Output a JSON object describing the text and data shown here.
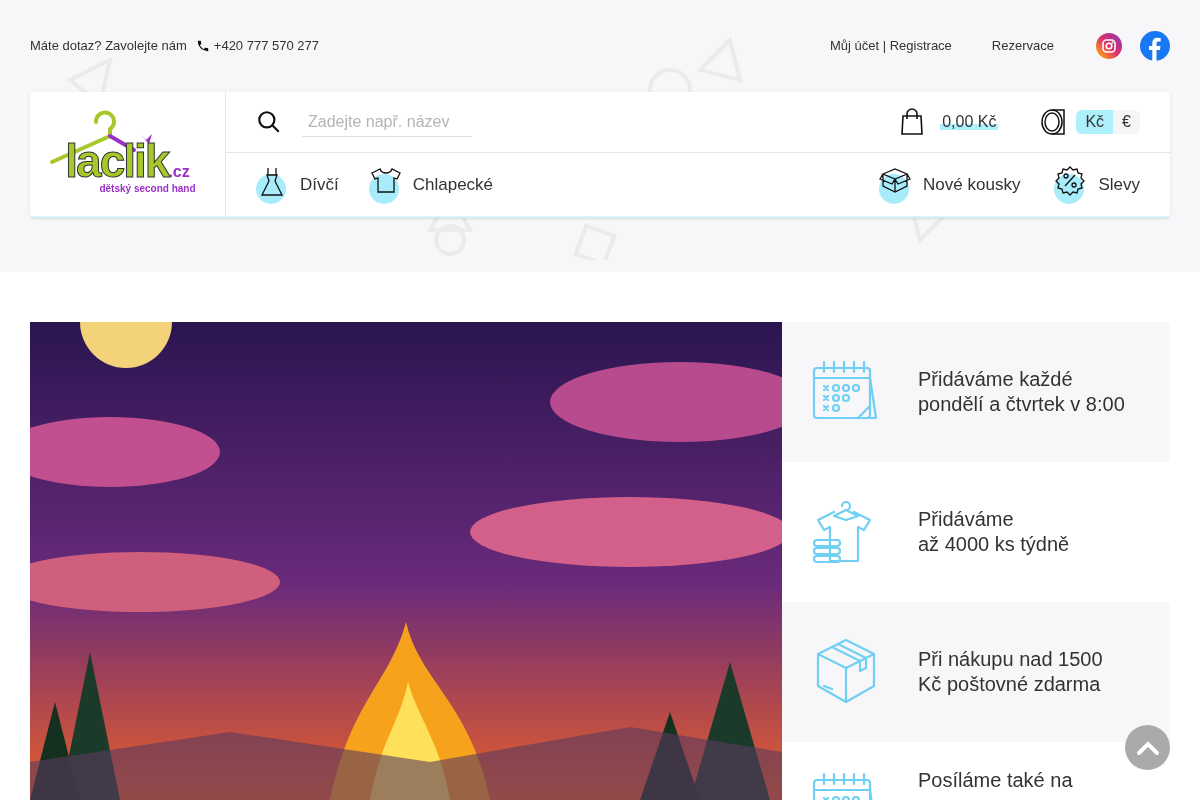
{
  "topbar": {
    "question": "Máte dotaz? Zavolejte nám",
    "phone": "+420 777 570 277",
    "account_link": "Můj účet | Registrace",
    "reservation_link": "Rezervace"
  },
  "logo": {
    "name": "laclik",
    "suffix": ".cz",
    "tagline": "dětský second hand"
  },
  "search": {
    "placeholder": "Zadejte např. název"
  },
  "cart": {
    "total": "0,00 Kč"
  },
  "currencies": [
    {
      "label": "Kč",
      "selected": true
    },
    {
      "label": "€",
      "selected": false
    }
  ],
  "categories": [
    {
      "label": "Dívčí",
      "kind": "dress"
    },
    {
      "label": "Chlapecké",
      "kind": "shirt"
    }
  ],
  "nav_right": [
    {
      "label": "Nové kousky",
      "kind": "box"
    },
    {
      "label": "Slevy",
      "kind": "percent"
    }
  ],
  "features": [
    {
      "text": "Přidáváme každé pondělí a čtvrtek v 8:00",
      "kind": "calendar"
    },
    {
      "text": "Přidáváme\naž 4000 ks týdně",
      "kind": "clothes"
    },
    {
      "text": "Při nákupu nad 1500\nKč poštovné zdarma",
      "kind": "parcel"
    },
    {
      "text": "Posíláme také na",
      "kind": "calendar"
    }
  ]
}
